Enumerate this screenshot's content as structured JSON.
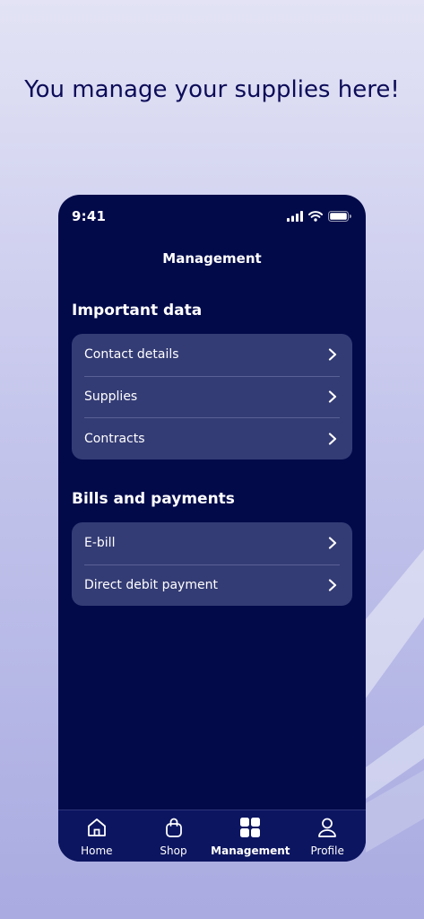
{
  "headline": "You manage your supplies here!",
  "colors": {
    "phone_background": "#020a4a",
    "card_background": "#343c75",
    "headline_color": "#0c0c58"
  },
  "status_bar": {
    "time": "9:41",
    "icons": [
      "signal-icon",
      "wifi-icon",
      "battery-icon"
    ]
  },
  "nav_title": "Management",
  "sections": [
    {
      "title": "Important data",
      "items": [
        {
          "label": "Contact details",
          "icon": "chevron-right-icon"
        },
        {
          "label": "Supplies",
          "icon": "chevron-right-icon"
        },
        {
          "label": "Contracts",
          "icon": "chevron-right-icon"
        }
      ]
    },
    {
      "title": "Bills and payments",
      "items": [
        {
          "label": "E-bill",
          "icon": "chevron-right-icon"
        },
        {
          "label": "Direct debit payment",
          "icon": "chevron-right-icon"
        }
      ]
    }
  ],
  "tabbar": {
    "active": "Management",
    "tabs": [
      {
        "label": "Home",
        "icon": "home-icon"
      },
      {
        "label": "Shop",
        "icon": "shopping-bag-icon"
      },
      {
        "label": "Management",
        "icon": "grid-icon"
      },
      {
        "label": "Profile",
        "icon": "user-icon"
      }
    ]
  }
}
